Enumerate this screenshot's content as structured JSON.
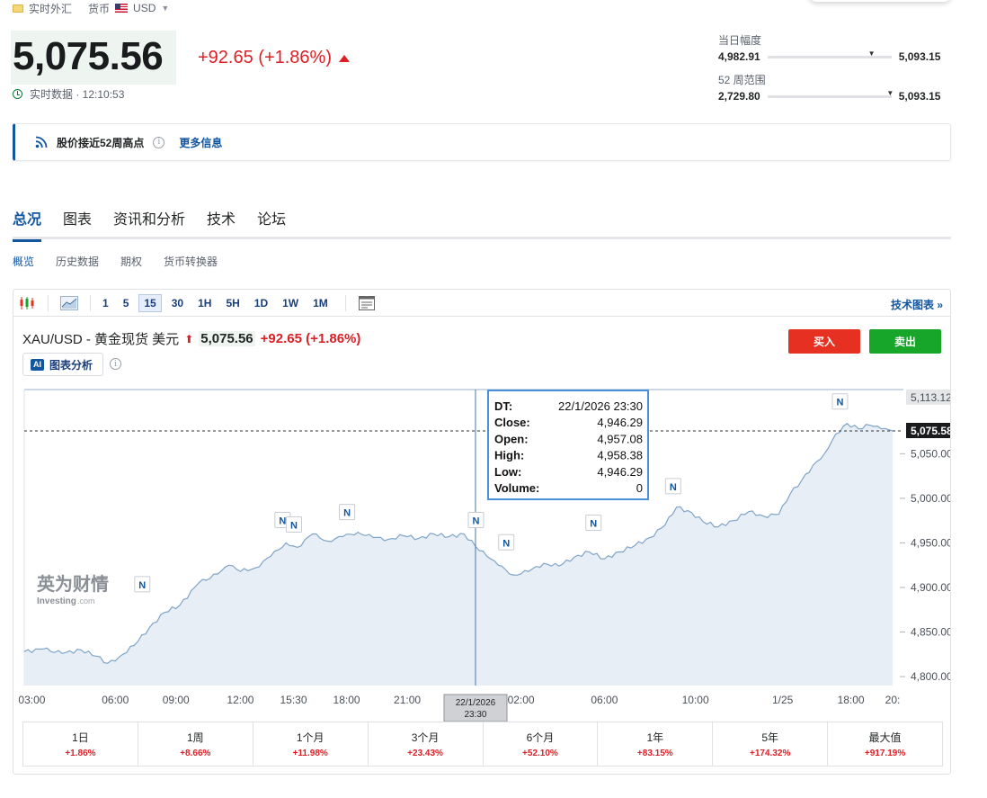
{
  "header": {
    "breadcrumb": [
      "实时外汇",
      "货币"
    ],
    "currency": "USD"
  },
  "quote": {
    "price": "5,075.56",
    "change": "+92.65 (+1.86%)",
    "realtime_label": "实时数据 · 12:10:53"
  },
  "ranges": {
    "day_label": "当日幅度",
    "day_low": "4,982.91",
    "day_high": "5,093.15",
    "day_position": 0.84,
    "week52_label": "52 周范围",
    "week52_low": "2,729.80",
    "week52_high": "5,093.15",
    "week52_position": 0.99
  },
  "notice": {
    "text": "股价接近52周高点",
    "more": "更多信息"
  },
  "main_tabs": [
    "总况",
    "图表",
    "资讯和分析",
    "技术",
    "论坛"
  ],
  "sub_tabs": [
    "概览",
    "历史数据",
    "期权",
    "货币转换器"
  ],
  "toolbar": {
    "timeframes": [
      "1",
      "5",
      "15",
      "30",
      "1H",
      "5H",
      "1D",
      "1W",
      "1M"
    ],
    "active_timeframe": "15",
    "tech_chart": "技术图表 »"
  },
  "symbol": {
    "name": "XAU/USD - 黄金现货 美元",
    "price": "5,075.56",
    "change": "+92.65 (+1.86%)",
    "ai_label": "图表分析",
    "buy": "买入",
    "sell": "卖出"
  },
  "watermark": {
    "cn": "英为财情",
    "en": "Investing",
    "suffix": ".com"
  },
  "colors": {
    "up": "#dd1e25",
    "accent": "#1256a0",
    "buy": "#e63022",
    "sell": "#17a52a",
    "area_fill": "#e7eef6",
    "line": "#7fa4c8"
  },
  "chart_data": {
    "type": "area",
    "ylim": [
      4790,
      5122
    ],
    "yticks": [
      4800,
      4850,
      4900,
      4950,
      5000,
      5050
    ],
    "ytick_labels": [
      "4,800.00",
      "4,850.00",
      "4,900.00",
      "4,950.00",
      "5,000.00",
      "5,050.00"
    ],
    "last_price_label": "5,075.58",
    "last_price": 5075.58,
    "high_label": "5,113.12",
    "high_value": 5113.12,
    "xtick_labels": [
      "03:00",
      "06:00",
      "09:00",
      "12:00",
      "15:30",
      "18:00",
      "21:00",
      "22/1/2026\n23:30",
      "02:00",
      "06:00",
      "10:00",
      "1/25",
      "18:00",
      "20:"
    ],
    "xtick_index": [
      2,
      24,
      40,
      57,
      71,
      85,
      101,
      119,
      131,
      153,
      177,
      200,
      218,
      229
    ],
    "n_points": 230,
    "crosshair_index": 119,
    "crosshair_axis_label_1": "22/1/2026",
    "crosshair_axis_label_2": "23:30",
    "tooltip": {
      "DT": "22/1/2026 23:30",
      "Close": "4,946.29",
      "Open": "4,957.08",
      "High": "4,958.38",
      "Low": "4,946.29",
      "Volume": "0"
    },
    "news_marker_label": "N",
    "news_markers": [
      {
        "index": 31,
        "value": 4885
      },
      {
        "index": 68,
        "value": 4957
      },
      {
        "index": 71,
        "value": 4952
      },
      {
        "index": 85,
        "value": 4966
      },
      {
        "index": 119,
        "value": 4957
      },
      {
        "index": 127,
        "value": 4932
      },
      {
        "index": 150,
        "value": 4954
      },
      {
        "index": 171,
        "value": 4995
      },
      {
        "index": 215,
        "value": 5090
      }
    ],
    "anchors": [
      [
        0,
        4828
      ],
      [
        5,
        4831
      ],
      [
        10,
        4826
      ],
      [
        15,
        4830
      ],
      [
        19,
        4823
      ],
      [
        22,
        4815
      ],
      [
        25,
        4822
      ],
      [
        29,
        4835
      ],
      [
        33,
        4855
      ],
      [
        37,
        4872
      ],
      [
        41,
        4880
      ],
      [
        46,
        4905
      ],
      [
        51,
        4915
      ],
      [
        54,
        4925
      ],
      [
        57,
        4918
      ],
      [
        61,
        4922
      ],
      [
        65,
        4935
      ],
      [
        69,
        4950
      ],
      [
        72,
        4945
      ],
      [
        76,
        4960
      ],
      [
        80,
        4952
      ],
      [
        84,
        4957
      ],
      [
        88,
        4962
      ],
      [
        92,
        4956
      ],
      [
        96,
        4954
      ],
      [
        100,
        4958
      ],
      [
        104,
        4955
      ],
      [
        108,
        4960
      ],
      [
        112,
        4957
      ],
      [
        116,
        4960
      ],
      [
        119,
        4946
      ],
      [
        122,
        4935
      ],
      [
        125,
        4925
      ],
      [
        129,
        4914
      ],
      [
        133,
        4918
      ],
      [
        137,
        4927
      ],
      [
        141,
        4924
      ],
      [
        145,
        4934
      ],
      [
        149,
        4940
      ],
      [
        153,
        4932
      ],
      [
        157,
        4940
      ],
      [
        161,
        4947
      ],
      [
        165,
        4956
      ],
      [
        169,
        4970
      ],
      [
        172,
        4990
      ],
      [
        176,
        4984
      ],
      [
        179,
        4974
      ],
      [
        183,
        4968
      ],
      [
        187,
        4975
      ],
      [
        191,
        4985
      ],
      [
        195,
        4980
      ],
      [
        199,
        4982
      ],
      [
        202,
        5005
      ],
      [
        205,
        5020
      ],
      [
        208,
        5037
      ],
      [
        211,
        5050
      ],
      [
        214,
        5072
      ],
      [
        217,
        5084
      ],
      [
        220,
        5078
      ],
      [
        223,
        5082
      ],
      [
        226,
        5078
      ],
      [
        229,
        5075.58
      ]
    ]
  },
  "performance": [
    {
      "label": "1日",
      "value": "+1.86%"
    },
    {
      "label": "1周",
      "value": "+8.66%"
    },
    {
      "label": "1个月",
      "value": "+11.98%"
    },
    {
      "label": "3个月",
      "value": "+23.43%"
    },
    {
      "label": "6个月",
      "value": "+52.10%"
    },
    {
      "label": "1年",
      "value": "+83.15%"
    },
    {
      "label": "5年",
      "value": "+174.32%"
    },
    {
      "label": "最大值",
      "value": "+917.19%"
    }
  ]
}
